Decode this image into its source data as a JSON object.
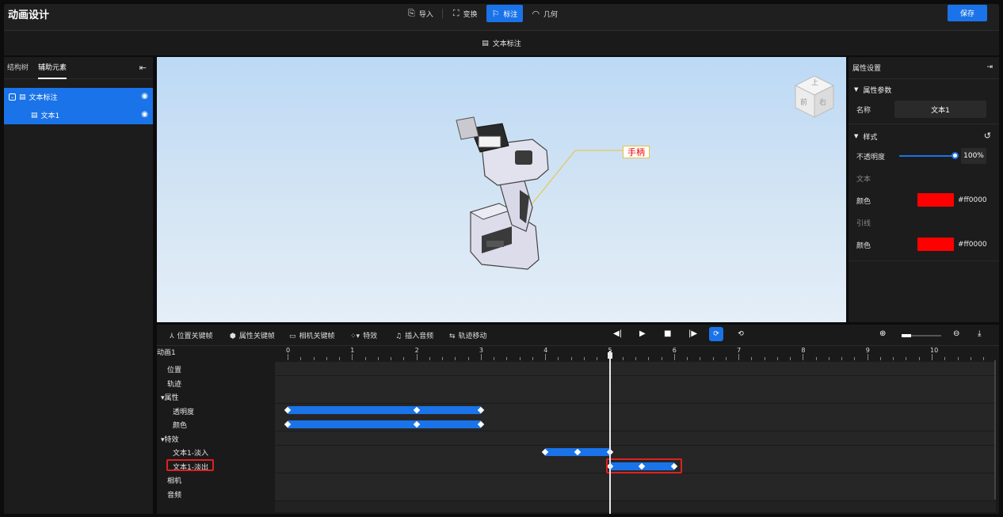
{
  "app": {
    "title": "动画设计",
    "save_label": "保存"
  },
  "mode_tabs": [
    {
      "label": "导入",
      "icon": "import-icon",
      "active": false
    },
    {
      "label": "变换",
      "icon": "transform-icon",
      "active": false
    },
    {
      "label": "标注",
      "icon": "annotation-icon",
      "active": true
    },
    {
      "label": "几何",
      "icon": "geometry-icon",
      "active": false
    }
  ],
  "subbar": {
    "label": "文本标注",
    "icon": "text-annotation-icon"
  },
  "left_panel": {
    "tabs": [
      {
        "label": "结构树",
        "active": false
      },
      {
        "label": "辅助元素",
        "active": true
      }
    ],
    "tree": [
      {
        "label": "文本标注",
        "level": 0
      },
      {
        "label": "文本1",
        "level": 1
      }
    ]
  },
  "viewport": {
    "annotation_label": "手柄",
    "viewcube_faces": {
      "top": "上",
      "front": "前",
      "right": "右"
    }
  },
  "properties": {
    "title": "属性设置",
    "params_section": "属性参数",
    "name_label": "名称",
    "name_value": "文本1",
    "style_section": "样式",
    "opacity_label": "不透明度",
    "opacity_value": "100%",
    "text_group": "文本",
    "text_color_label": "颜色",
    "text_color_hex": "#ff0000",
    "leader_group": "引线",
    "leader_color_label": "颜色",
    "leader_color_hex": "#ff0000"
  },
  "timeline": {
    "tools": [
      {
        "label": "位置关键帧",
        "icon": "position-keyframe-icon"
      },
      {
        "label": "属性关键帧",
        "icon": "property-keyframe-icon"
      },
      {
        "label": "相机关键帧",
        "icon": "camera-keyframe-icon"
      },
      {
        "label": "特效",
        "icon": "effects-icon"
      },
      {
        "label": "插入音频",
        "icon": "audio-icon"
      },
      {
        "label": "轨迹移动",
        "icon": "path-move-icon"
      }
    ],
    "animation_name": "动画1",
    "tracks": [
      {
        "label": "位置",
        "indent": 1
      },
      {
        "label": "轨迹",
        "indent": 1
      },
      {
        "label": "▾属性",
        "indent": 0
      },
      {
        "label": "透明度",
        "indent": 2
      },
      {
        "label": "颜色",
        "indent": 2
      },
      {
        "label": "▾特效",
        "indent": 0
      },
      {
        "label": "文本1-淡入",
        "indent": 2
      },
      {
        "label": "文本1-淡出",
        "indent": 2
      },
      {
        "label": "相机",
        "indent": 1
      },
      {
        "label": "音频",
        "indent": 1
      }
    ],
    "ruler_ticks": [
      "0",
      "1",
      "2",
      "3",
      "4",
      "5",
      "6",
      "7",
      "8",
      "9",
      "10",
      "1"
    ],
    "playhead_time": 5,
    "keyframe_bars": [
      {
        "track": 3,
        "start": 0,
        "end": 3,
        "keys": [
          0,
          2,
          3
        ]
      },
      {
        "track": 4,
        "start": 0,
        "end": 3,
        "keys": [
          0,
          2,
          3
        ]
      },
      {
        "track": 6,
        "start": 4,
        "end": 5,
        "keys": [
          4,
          4.5,
          5
        ]
      },
      {
        "track": 7,
        "start": 5,
        "end": 6,
        "keys": [
          5,
          5.5,
          6
        ]
      }
    ],
    "highlighted_track": 7
  },
  "colors": {
    "accent": "#1a73e8",
    "highlight": "#e02020",
    "text_color": "#ff0000"
  }
}
